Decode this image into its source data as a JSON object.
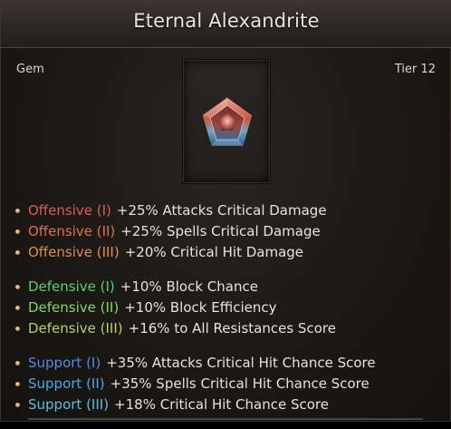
{
  "item": {
    "name": "Eternal Alexandrite",
    "type": "Gem",
    "tier": "Tier 12",
    "icon": "pentagon-gem-icon"
  },
  "groups": [
    {
      "name": "offensive",
      "lines": [
        {
          "tag": "Offensive (I)",
          "text": "+25% Attacks Critical Damage",
          "color": "#e15a5c"
        },
        {
          "tag": "Offensive (II)",
          "text": "+25% Spells Critical Damage",
          "color": "#e26e56"
        },
        {
          "tag": "Offensive (III)",
          "text": "+20% Critical Hit Damage",
          "color": "#e08a54"
        }
      ]
    },
    {
      "name": "defensive",
      "lines": [
        {
          "tag": "Defensive (I)",
          "text": "+10% Block Chance",
          "color": "#5ed06a"
        },
        {
          "tag": "Defensive (II)",
          "text": "+10% Block Efficiency",
          "color": "#86d463"
        },
        {
          "tag": "Defensive (III)",
          "text": "+16% to All Resistances Score",
          "color": "#b7cf6a"
        }
      ]
    },
    {
      "name": "support",
      "lines": [
        {
          "tag": "Support (I)",
          "text": "+35% Attacks Critical Hit Chance Score",
          "color": "#5a86e6"
        },
        {
          "tag": "Support (II)",
          "text": "+35% Spells Critical Hit Chance Score",
          "color": "#55a2e8"
        },
        {
          "tag": "Support (III)",
          "text": "+18% Critical Hit Chance Score",
          "color": "#60bde0"
        }
      ]
    }
  ]
}
